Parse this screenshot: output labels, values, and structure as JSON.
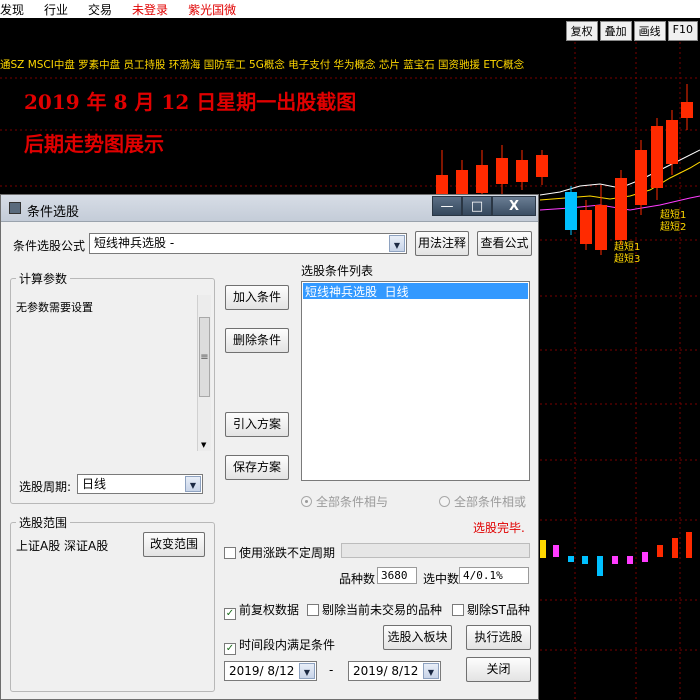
{
  "menu": {
    "items": [
      {
        "label": "发现",
        "red": false
      },
      {
        "label": "行业",
        "red": false
      },
      {
        "label": "交易",
        "red": false
      },
      {
        "label": "未登录",
        "red": true
      },
      {
        "label": "紫光国微",
        "red": true
      }
    ]
  },
  "toolbar": {
    "buttons": [
      "复权",
      "叠加",
      "画线",
      "F10"
    ]
  },
  "sectors_text": "通SZ MSCI中盘 罗素中盘 员工持股 环渤海 国防军工 5G概念 电子支付 华为概念 芯片 蓝宝石 国资驰援 ETC概念",
  "headline": {
    "line1": "2019 年 8 月 12 日星期一出股截图",
    "line2": "后期走势图展示"
  },
  "chart": {
    "annotations": [
      "超短1",
      "超短2",
      "超短1",
      "超短3"
    ],
    "up_color": "#ff2a00",
    "down_color": "#00c0ff"
  },
  "dialog": {
    "title": "条件选股",
    "formula_label": "条件选股公式",
    "formula_value": "短线神兵选股 -",
    "usage_button": "用法注释",
    "view_formula_button": "查看公式",
    "params_group": "计算参数",
    "params_text": "无参数需要设置",
    "period_label": "选股周期:",
    "period_value": "日线",
    "add_condition": "加入条件",
    "delete_condition": "删除条件",
    "import_scheme": "引入方案",
    "save_scheme": "保存方案",
    "condition_list_label": "选股条件列表",
    "condition_items": [
      "短线神兵选股  日线"
    ],
    "radio_and": "全部条件相与",
    "radio_or": "全部条件相或",
    "radio_and_checked": true,
    "status": "选股完毕.",
    "range_group": "选股范围",
    "range_text": "上证A股 深证A股",
    "change_range_button": "改变范围",
    "use_irregular_label": "使用涨跌不定周期",
    "use_irregular_checked": false,
    "count_label": "品种数",
    "count_value": "3680",
    "selected_label": "选中数",
    "selected_value": "4/0.1%",
    "pre_adjust_label": "前复权数据",
    "pre_adjust_checked": true,
    "exclude_untraded_label": "剔除当前未交易的品种",
    "exclude_untraded_checked": false,
    "exclude_st_label": "剔除ST品种",
    "exclude_st_checked": false,
    "time_range_label": "时间段内满足条件",
    "time_range_checked": true,
    "add_to_block_button": "选股入板块",
    "execute_button": "执行选股",
    "date_from": "2019/ 8/12",
    "date_to": "2019/ 8/12",
    "date_sep": "-",
    "close_button": "关闭"
  }
}
